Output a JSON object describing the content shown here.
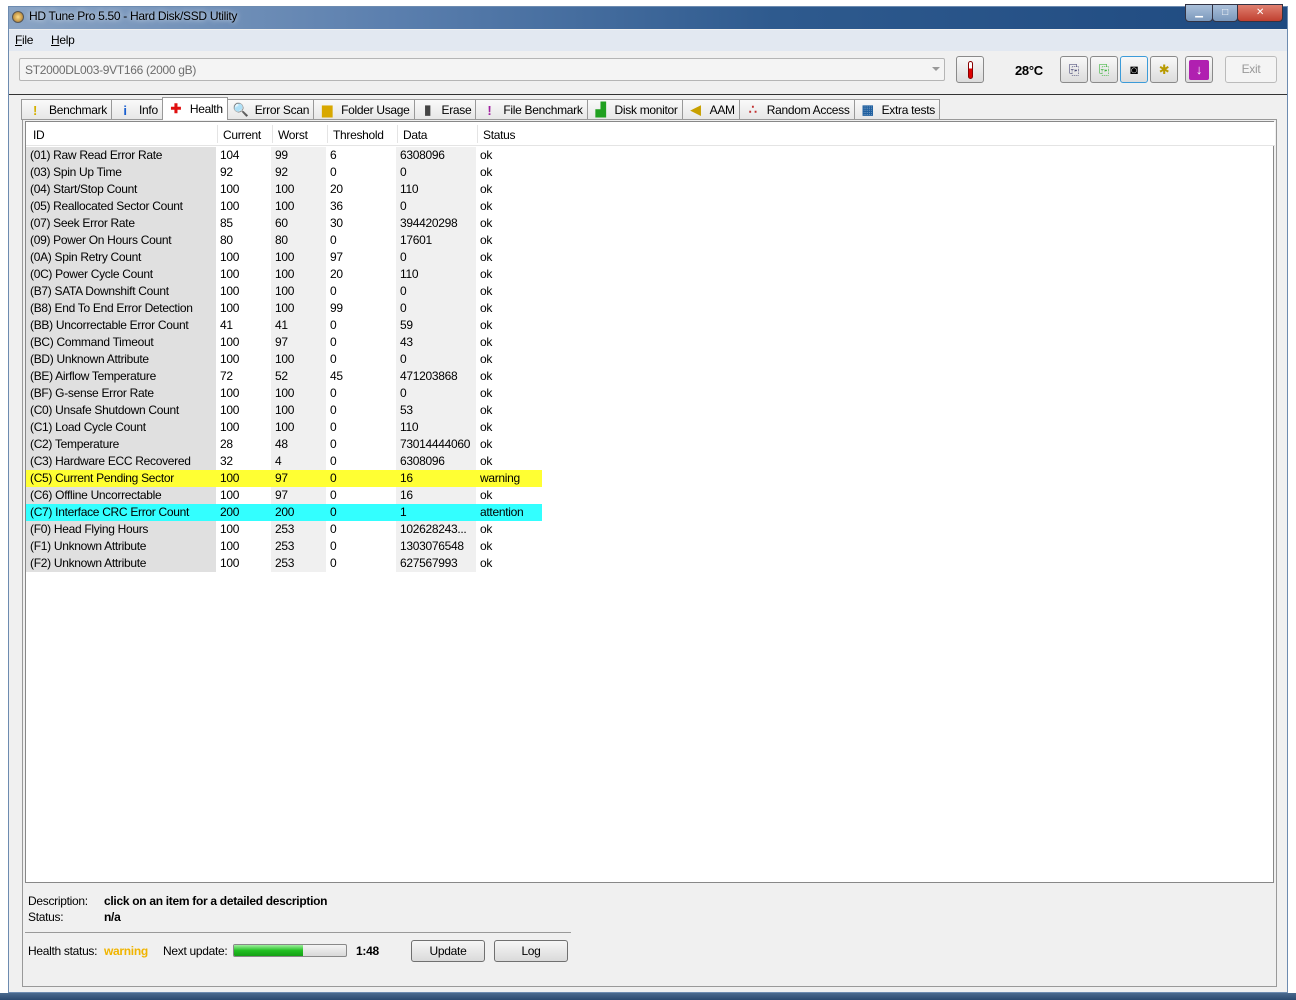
{
  "window": {
    "title": "HD Tune Pro 5.50 - Hard Disk/SSD Utility"
  },
  "menu": [
    {
      "label": "File",
      "key": "F",
      "rest": "ile"
    },
    {
      "label": "Help",
      "key": "H",
      "rest": "elp"
    }
  ],
  "toolbar": {
    "drive": "ST2000DL003-9VT166 (2000 gB)",
    "temperature": "28°C",
    "exit_label": "Exit",
    "icons": [
      "copy-text-icon",
      "copy-screenshot-icon",
      "camera-icon",
      "options-icon",
      "save-download-icon"
    ]
  },
  "tabs": [
    {
      "label": "Benchmark",
      "icon": "benchmark-icon",
      "glyph": "!",
      "color": "#d4b000"
    },
    {
      "label": "Info",
      "icon": "info-icon",
      "glyph": "i",
      "color": "#1a5fd0"
    },
    {
      "label": "Health",
      "icon": "health-cross-icon",
      "glyph": "✚",
      "color": "#e01010",
      "active": true
    },
    {
      "label": "Error Scan",
      "icon": "magnifier-icon",
      "glyph": "🔍",
      "color": "#2a8a2a"
    },
    {
      "label": "Folder Usage",
      "icon": "folder-icon",
      "glyph": "▆",
      "color": "#d8a800"
    },
    {
      "label": "Erase",
      "icon": "trash-icon",
      "glyph": "▮",
      "color": "#444"
    },
    {
      "label": "File Benchmark",
      "icon": "file-benchmark-icon",
      "glyph": "!",
      "color": "#a020a0"
    },
    {
      "label": "Disk monitor",
      "icon": "disk-monitor-icon",
      "glyph": "▟",
      "color": "#20a020"
    },
    {
      "label": "AAM",
      "icon": "speaker-icon",
      "glyph": "◀",
      "color": "#c8a000"
    },
    {
      "label": "Random Access",
      "icon": "random-access-icon",
      "glyph": "∴",
      "color": "#c03030"
    },
    {
      "label": "Extra tests",
      "icon": "extra-tests-icon",
      "glyph": "▦",
      "color": "#2060a0"
    }
  ],
  "table": {
    "columns": [
      "ID",
      "Current",
      "Worst",
      "Threshold",
      "Data",
      "Status"
    ],
    "rows": [
      [
        "(01) Raw Read Error Rate",
        "104",
        "99",
        "6",
        "6308096",
        "ok"
      ],
      [
        "(03) Spin Up Time",
        "92",
        "92",
        "0",
        "0",
        "ok"
      ],
      [
        "(04) Start/Stop Count",
        "100",
        "100",
        "20",
        "110",
        "ok"
      ],
      [
        "(05) Reallocated Sector Count",
        "100",
        "100",
        "36",
        "0",
        "ok"
      ],
      [
        "(07) Seek Error Rate",
        "85",
        "60",
        "30",
        "394420298",
        "ok"
      ],
      [
        "(09) Power On Hours Count",
        "80",
        "80",
        "0",
        "17601",
        "ok"
      ],
      [
        "(0A) Spin Retry Count",
        "100",
        "100",
        "97",
        "0",
        "ok"
      ],
      [
        "(0C) Power Cycle Count",
        "100",
        "100",
        "20",
        "110",
        "ok"
      ],
      [
        "(B7) SATA Downshift Count",
        "100",
        "100",
        "0",
        "0",
        "ok"
      ],
      [
        "(B8) End To End Error Detection",
        "100",
        "100",
        "99",
        "0",
        "ok"
      ],
      [
        "(BB) Uncorrectable Error Count",
        "41",
        "41",
        "0",
        "59",
        "ok"
      ],
      [
        "(BC) Command Timeout",
        "100",
        "97",
        "0",
        "43",
        "ok"
      ],
      [
        "(BD) Unknown Attribute",
        "100",
        "100",
        "0",
        "0",
        "ok"
      ],
      [
        "(BE) Airflow Temperature",
        "72",
        "52",
        "45",
        "471203868",
        "ok"
      ],
      [
        "(BF) G-sense Error Rate",
        "100",
        "100",
        "0",
        "0",
        "ok"
      ],
      [
        "(C0) Unsafe Shutdown Count",
        "100",
        "100",
        "0",
        "53",
        "ok"
      ],
      [
        "(C1) Load Cycle Count",
        "100",
        "100",
        "0",
        "110",
        "ok"
      ],
      [
        "(C2) Temperature",
        "28",
        "48",
        "0",
        "73014444060",
        "ok"
      ],
      [
        "(C3) Hardware ECC Recovered",
        "32",
        "4",
        "0",
        "6308096",
        "ok"
      ],
      [
        "(C5) Current Pending Sector",
        "100",
        "97",
        "0",
        "16",
        "warning"
      ],
      [
        "(C6) Offline Uncorrectable",
        "100",
        "97",
        "0",
        "16",
        "ok"
      ],
      [
        "(C7) Interface CRC Error Count",
        "200",
        "200",
        "0",
        "1",
        "attention"
      ],
      [
        "(F0) Head Flying Hours",
        "100",
        "253",
        "0",
        "102628243...",
        "ok"
      ],
      [
        "(F1) Unknown Attribute",
        "100",
        "253",
        "0",
        "1303076548",
        "ok"
      ],
      [
        "(F2) Unknown Attribute",
        "100",
        "253",
        "0",
        "627567993",
        "ok"
      ]
    ],
    "status_colors": {
      "warning": "#ffff33",
      "attention": "#33ffff"
    }
  },
  "details": {
    "description_label": "Description:",
    "description": "click on an item for a detailed description",
    "status_label": "Status:",
    "status": "n/a"
  },
  "footer": {
    "health_label": "Health status:",
    "health": "warning",
    "health_color": "#f0b400",
    "next_update_label": "Next update:",
    "progress": 0.62,
    "countdown": "1:48",
    "update_label": "Update",
    "log_label": "Log"
  }
}
